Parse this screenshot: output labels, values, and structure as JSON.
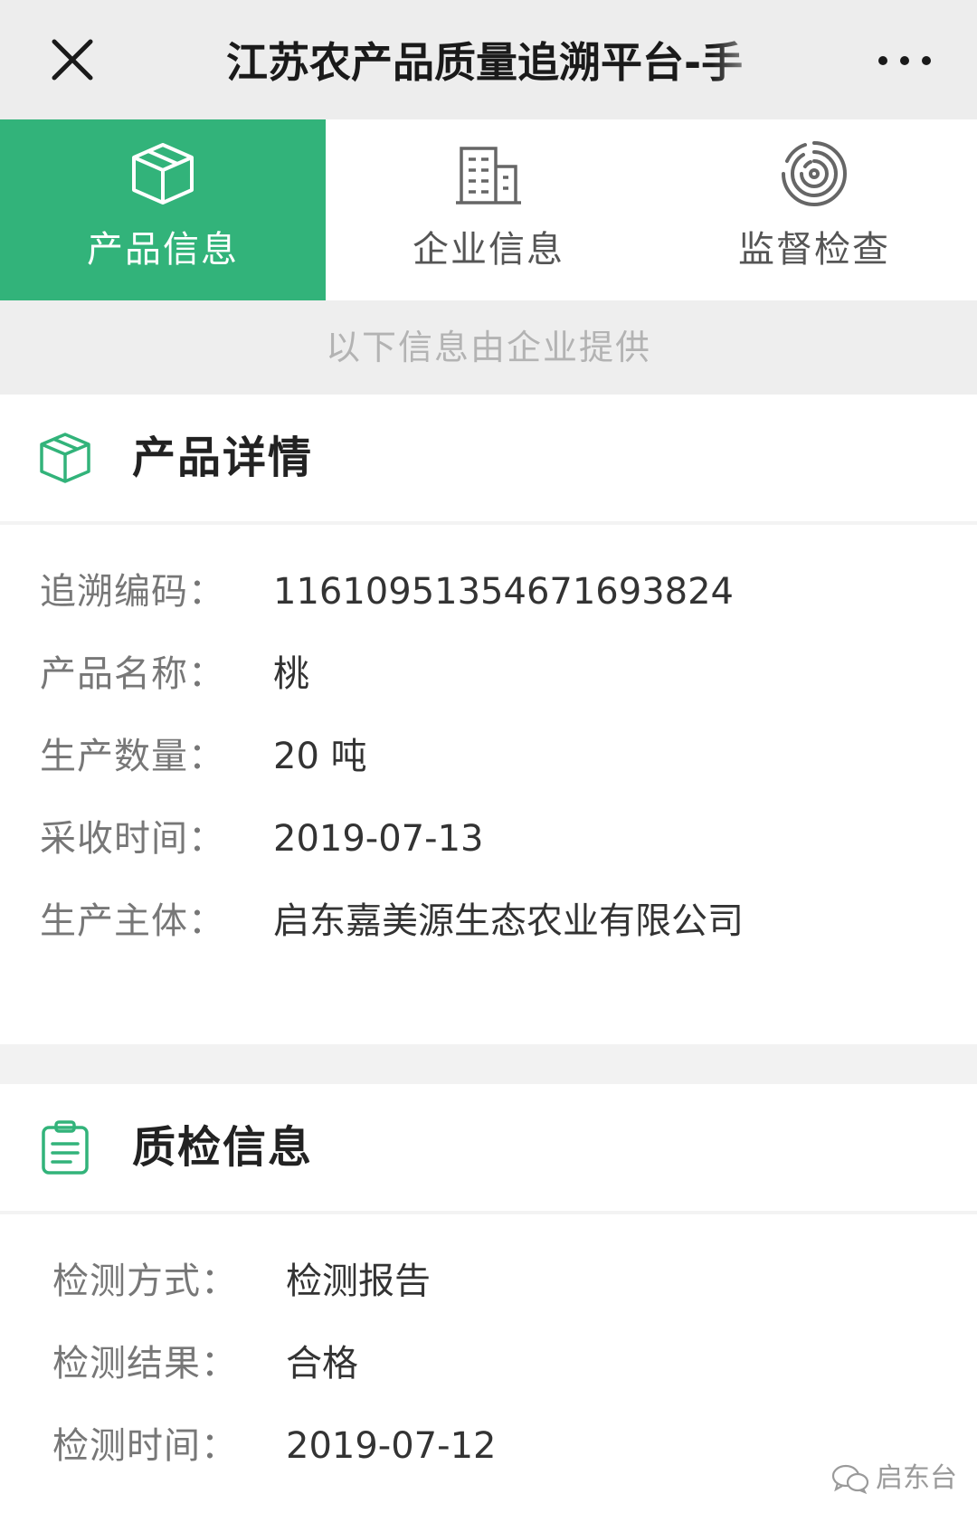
{
  "header": {
    "title": "江苏农产品质量追溯平台-手",
    "close_icon": "close-icon",
    "more_icon": "more-horizontal-icon"
  },
  "tabs": [
    {
      "label": "产品信息",
      "icon": "box-icon",
      "active": true
    },
    {
      "label": "企业信息",
      "icon": "building-icon",
      "active": false
    },
    {
      "label": "监督检查",
      "icon": "fingerprint-icon",
      "active": false
    }
  ],
  "notice": "以下信息由企业提供",
  "product": {
    "title": "产品详情",
    "icon": "box-icon",
    "rows": [
      {
        "label": "追溯编码：",
        "value": "1161095135467169382​4"
      },
      {
        "label": "产品名称：",
        "value": "桃"
      },
      {
        "label": "生产数量：",
        "value": "20 吨"
      },
      {
        "label": "采收时间：",
        "value": "2019-07-13"
      },
      {
        "label": "生产主体：",
        "value": "启东嘉美源生态农业有限公司"
      }
    ]
  },
  "inspection": {
    "title": "质检信息",
    "icon": "clipboard-icon",
    "rows": [
      {
        "label": "检测方式：",
        "value": "检测报告"
      },
      {
        "label": "检测结果：",
        "value": "合格"
      },
      {
        "label": "检测时间：",
        "value": "2019-07-12"
      }
    ]
  },
  "watermark": {
    "text": "启东台",
    "icon": "wechat-icon"
  },
  "colors": {
    "accent": "#32b37a",
    "page_bg": "#f2f2f2"
  }
}
